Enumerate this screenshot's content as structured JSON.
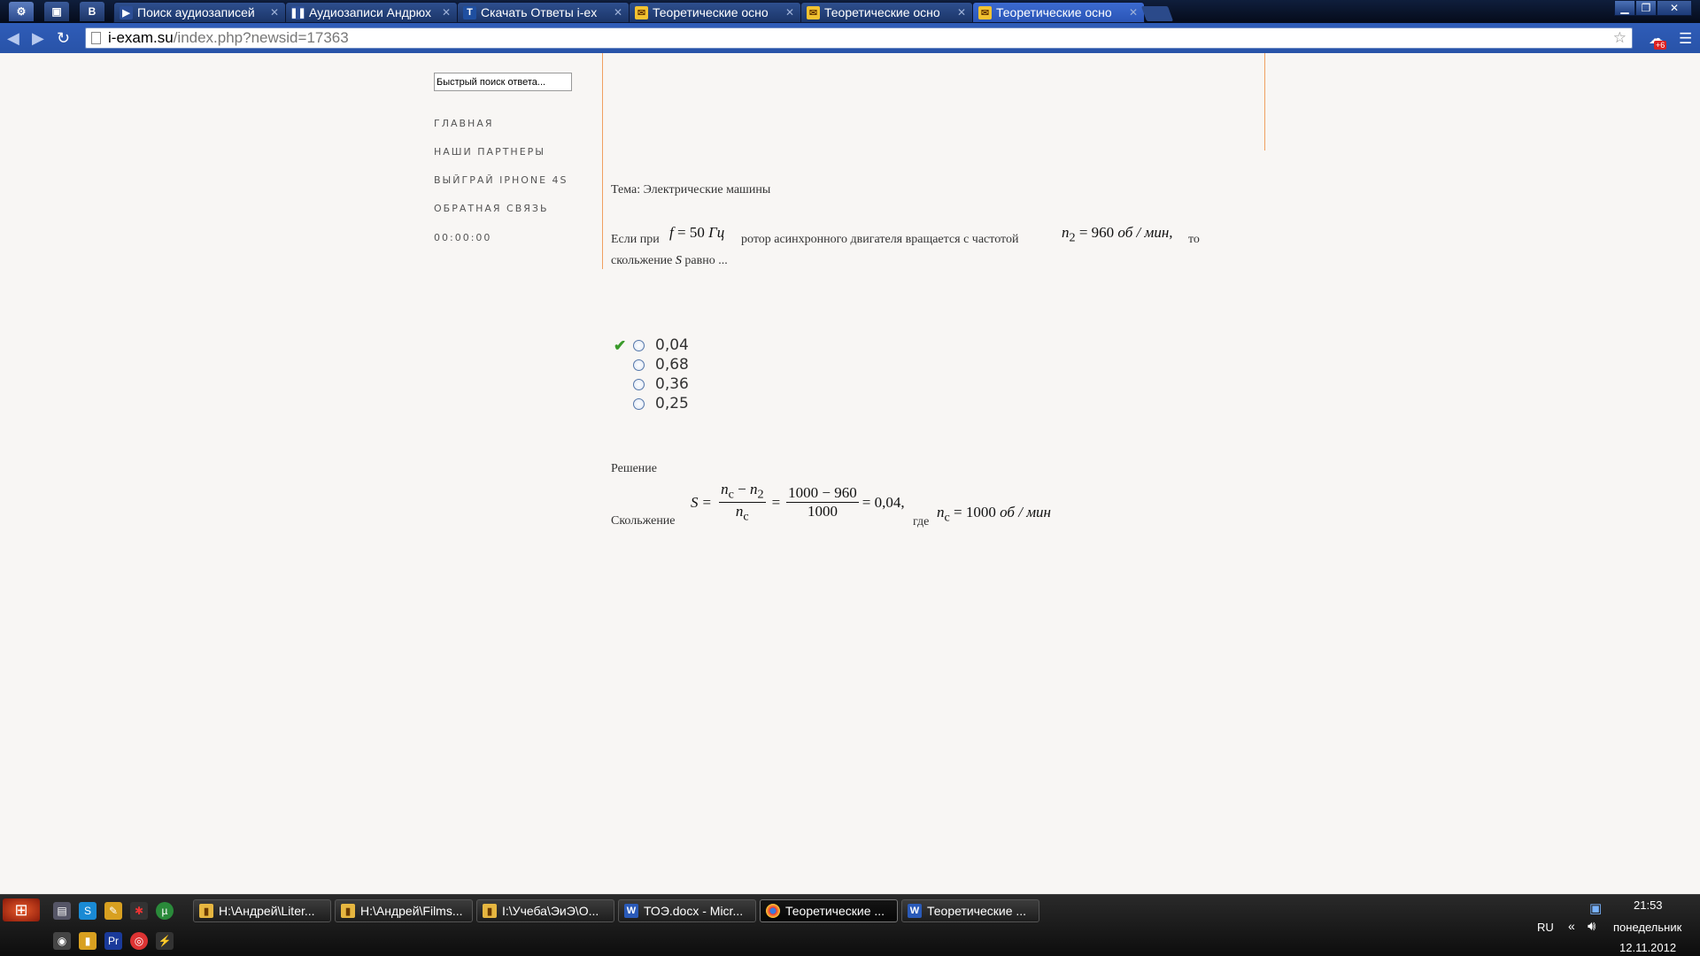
{
  "browser": {
    "tabs": [
      {
        "label": "Поиск аудиозаписей",
        "icon": "play-icon",
        "active": false
      },
      {
        "label": "Аудиозаписи Андрюх",
        "icon": "pause-icon",
        "active": false
      },
      {
        "label": "Скачать Ответы i-ex",
        "icon": "t-icon",
        "active": false
      },
      {
        "label": "Теоретические осно",
        "icon": "envelope-icon",
        "active": false
      },
      {
        "label": "Теоретические осно",
        "icon": "envelope-icon",
        "active": false
      },
      {
        "label": "Теоретические осно",
        "icon": "envelope-icon",
        "active": true
      }
    ],
    "pinned_label": "B",
    "url_host": "i-exam.su",
    "url_path": "/index.php?newsid=17363",
    "extension_badge": "+6",
    "colors": {
      "toolbar": "#2f5cb8",
      "accent_line": "#f0a060",
      "check": "#3a9a2a"
    }
  },
  "sidebar": {
    "search_value": "Быстрый поиск ответа...",
    "menu": [
      "ГЛАВНАЯ",
      "НАШИ ПАРТНЕРЫ",
      "ВЫЙГРАЙ IPHONE 4S",
      "ОБРАТНАЯ СВЯЗЬ",
      "00:00:00"
    ]
  },
  "question": {
    "topic": "Тема: Электрические машины",
    "text_1": "Если при",
    "f_var": "f",
    "f_value": "= 50",
    "f_unit": "Гц",
    "text_2": "ротор асинхронного двигателя вращается с частотой",
    "n2_var": "n",
    "n2_sub": "2",
    "n2_value": "= 960",
    "n2_unit": "об / мин,",
    "text_3": "то",
    "text_4": "скольжение",
    "s_var": "S",
    "text_5": "равно ..."
  },
  "answers": [
    {
      "value": "0,04",
      "correct": true
    },
    {
      "value": "0,68",
      "correct": false
    },
    {
      "value": "0,36",
      "correct": false
    },
    {
      "value": "0,25",
      "correct": false
    }
  ],
  "solution": {
    "label": "Решение",
    "slip_label": "Скольжение",
    "s": "S",
    "eq": "=",
    "num1": "n",
    "num1_sub": "c",
    "minus": "−",
    "num2": "n",
    "num2_sub": "2",
    "den": "n",
    "den_sub": "c",
    "frac2_num": "1000 − 960",
    "frac2_den": "1000",
    "result": "= 0,04,",
    "where": "где",
    "nc": "n",
    "nc_sub": "c",
    "nc_value": "= 1000",
    "nc_unit": "об / мин"
  },
  "taskbar": {
    "tasks": [
      {
        "label": "H:\\Андрей\\Liter...",
        "icon": "folder-icon",
        "active": false
      },
      {
        "label": "H:\\Андрей\\Films...",
        "icon": "folder-icon",
        "active": false
      },
      {
        "label": "I:\\Учеба\\ЭиЭ\\О...",
        "icon": "folder-icon",
        "active": false
      },
      {
        "label": "ТОЭ.docx - Micr...",
        "icon": "word-icon",
        "active": false
      },
      {
        "label": "Теоретические ...",
        "icon": "chrome-icon",
        "active": true
      },
      {
        "label": "Теоретические ...",
        "icon": "word-icon",
        "active": false
      }
    ],
    "language": "RU",
    "time": "21:53",
    "day": "понедельник",
    "date": "12.11.2012"
  }
}
